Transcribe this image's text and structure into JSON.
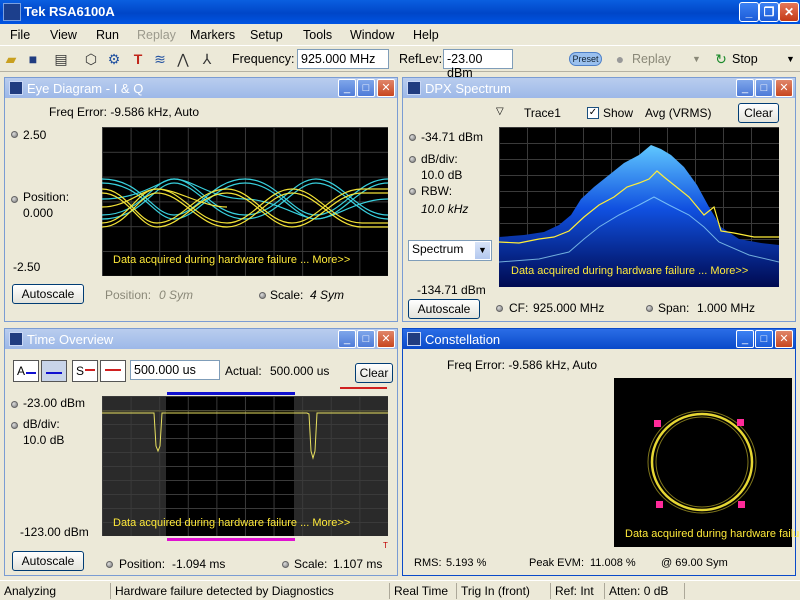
{
  "app": {
    "title": "Tek RSA6100A"
  },
  "menu": [
    "File",
    "View",
    "Run",
    "Replay",
    "Markers",
    "Setup",
    "Tools",
    "Window",
    "Help"
  ],
  "toolbar": {
    "frequency_label": "Frequency:",
    "frequency_value": "925.000 MHz",
    "reflev_label": "RefLev:",
    "reflev_value": "-23.00 dBm",
    "preset_label": "Preset",
    "replay_label": "Replay",
    "stop_label": "Stop"
  },
  "eye": {
    "title": "Eye Diagram - I & Q",
    "freq_error": "Freq Error: -9.586 kHz, Auto",
    "top": "2.50",
    "position_label": "Position:",
    "position_value": "0.000",
    "bottom": "-2.50",
    "autoscale": "Autoscale",
    "x_position_label": "Position:",
    "x_position_value": "0 Sym",
    "scale_label": "Scale:",
    "scale_value": "4 Sym",
    "warning": "Data acquired during hardware failure ... More>>"
  },
  "dpx": {
    "title": "DPX Spectrum",
    "trace": "Trace1",
    "show": "Show",
    "detector": "Avg (VRMS)",
    "clear": "Clear",
    "ref": "-34.71 dBm",
    "dbdiv_label": "dB/div:",
    "dbdiv_value": "10.0 dB",
    "rbw_label": "RBW:",
    "rbw_value": "10.0 kHz",
    "mode": "Spectrum",
    "bottom": "-134.71 dBm",
    "autoscale": "Autoscale",
    "cf_label": "CF:",
    "cf_value": "925.000 MHz",
    "span_label": "Span:",
    "span_value": "1.000 MHz",
    "warning": "Data acquired during hardware failure ... More>>"
  },
  "time": {
    "title": "Time Overview",
    "a_label": "A",
    "s_label": "S",
    "duration": "500.000 us",
    "actual_label": "Actual:",
    "actual_value": "500.000 us",
    "clear": "Clear",
    "ref": "-23.00 dBm",
    "dbdiv_label": "dB/div:",
    "dbdiv_value": "10.0 dB",
    "bottom": "-123.00 dBm",
    "autoscale": "Autoscale",
    "position_label": "Position:",
    "position_value": "-1.094 ms",
    "scale_label": "Scale:",
    "scale_value": "1.107 ms",
    "t_marker": "T",
    "warning": "Data acquired during hardware failure ... More>>"
  },
  "const": {
    "title": "Constellation",
    "freq_error": "Freq Error: -9.586 kHz, Auto",
    "rms_label": "RMS:",
    "rms_value": "5.193 %",
    "peak_label": "Peak EVM:",
    "peak_value": "11.008 %",
    "at_value": "@ 69.00 Sym",
    "warning": "Data acquired during hardware failure"
  },
  "status": [
    "Analyzing",
    "Hardware failure detected by Diagnostics",
    "Real Time",
    "Trig In (front)",
    "Ref: Int",
    "Atten: 0 dB"
  ],
  "colors": {
    "titlebar": "#0054E3",
    "eye_i": "#3fe6f5",
    "eye_q": "#ffee3a",
    "warning": "#ffea3a",
    "marker": "#ff2a9a",
    "blue_bar": "#1010d0",
    "magenta_bar": "#e010d0"
  }
}
